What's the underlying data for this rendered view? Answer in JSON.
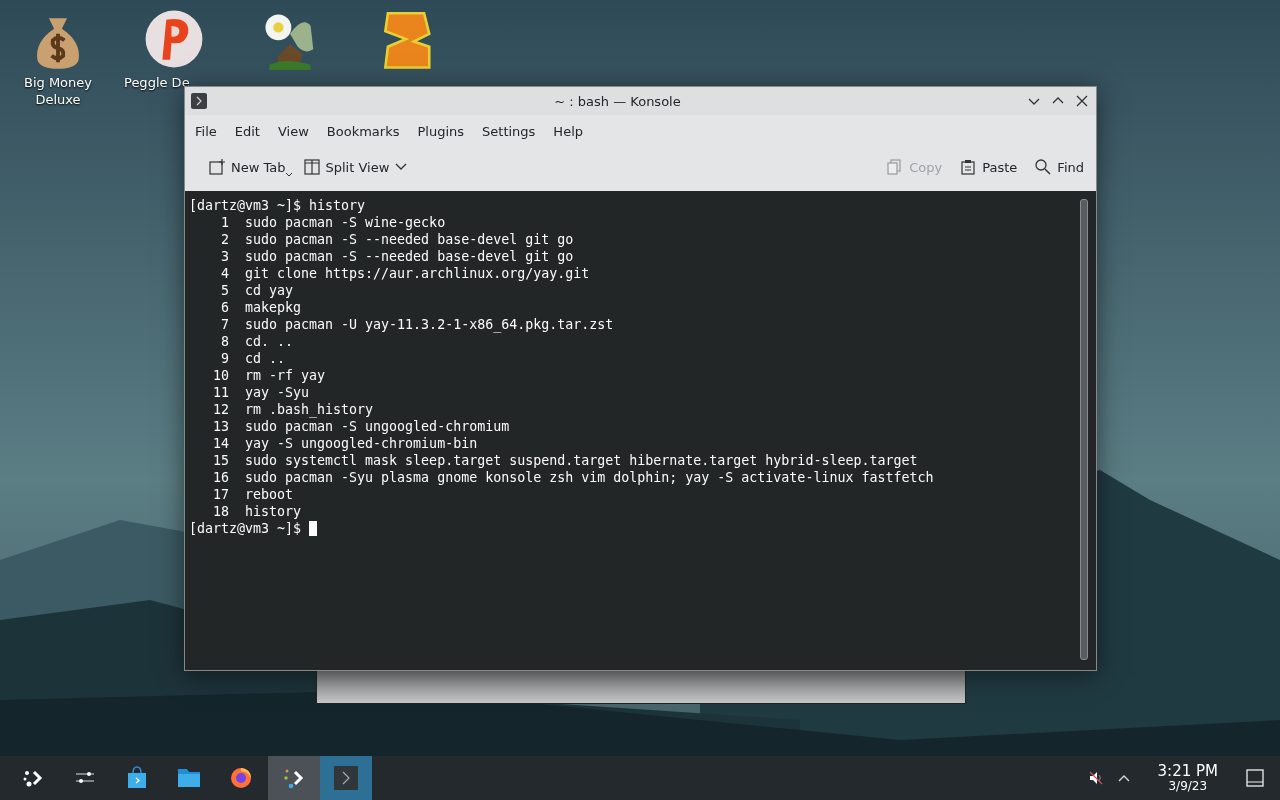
{
  "desktop_icons": [
    {
      "label": "Big Money Deluxe",
      "kind": "moneybag"
    },
    {
      "label": "Peggle De",
      "kind": "peggle",
      "clipped": true
    },
    {
      "kind": "plant"
    },
    {
      "kind": "zuma"
    }
  ],
  "window": {
    "title": "~ : bash — Konsole",
    "menu": [
      "File",
      "Edit",
      "View",
      "Bookmarks",
      "Plugins",
      "Settings",
      "Help"
    ],
    "toolbar": [
      {
        "label": "New Tab",
        "kind": "newtab",
        "disabled": false
      },
      {
        "label": "Split View",
        "kind": "split",
        "disabled": false
      },
      {
        "label": "Copy",
        "kind": "copy",
        "disabled": true
      },
      {
        "label": "Paste",
        "kind": "paste",
        "disabled": false
      },
      {
        "label": "Find",
        "kind": "find",
        "disabled": false
      }
    ],
    "terminal": {
      "prompt": "[dartz@vm3 ~]$",
      "command": "history",
      "history": [
        {
          "number": "1",
          "command": "sudo pacman -S wine-gecko"
        },
        {
          "number": "2",
          "command": "sudo pacman -S --needed base-devel git go"
        },
        {
          "number": "3",
          "command": "sudo pacman -S --needed base-devel git go"
        },
        {
          "number": "4",
          "command": "git clone https://aur.archlinux.org/yay.git"
        },
        {
          "number": "5",
          "command": "cd yay"
        },
        {
          "number": "6",
          "command": "makepkg"
        },
        {
          "number": "7",
          "command": "sudo pacman -U yay-11.3.2-1-x86_64.pkg.tar.zst"
        },
        {
          "number": "8",
          "command": "cd. .."
        },
        {
          "number": "9",
          "command": "cd .."
        },
        {
          "number": "10",
          "command": "rm -rf yay"
        },
        {
          "number": "11",
          "command": "yay -Syu"
        },
        {
          "number": "12",
          "command": "rm .bash_history"
        },
        {
          "number": "13",
          "command": "sudo pacman -S ungoogled-chromium"
        },
        {
          "number": "14",
          "command": "yay -S ungoogled-chromium-bin"
        },
        {
          "number": "15",
          "command": "sudo systemctl mask sleep.target suspend.target hibernate.target hybrid-sleep.target"
        },
        {
          "number": "16",
          "command": "sudo pacman -Syu plasma gnome konsole zsh vim dolphin; yay -S activate-linux fastfetch"
        },
        {
          "number": "17",
          "command": "reboot"
        },
        {
          "number": "18",
          "command": "history"
        }
      ],
      "final_prompt": "[dartz@vm3 ~]$"
    }
  },
  "taskbar": {
    "items": [
      {
        "kind": "launcher",
        "selected": false
      },
      {
        "kind": "settings",
        "selected": false
      },
      {
        "kind": "store",
        "selected": false
      },
      {
        "kind": "folder",
        "selected": false
      },
      {
        "kind": "browser",
        "selected": false
      },
      {
        "kind": "dots",
        "selected": false
      },
      {
        "kind": "terminal",
        "selected": true
      }
    ],
    "time": "3:21 PM",
    "date": "3/9/23"
  }
}
